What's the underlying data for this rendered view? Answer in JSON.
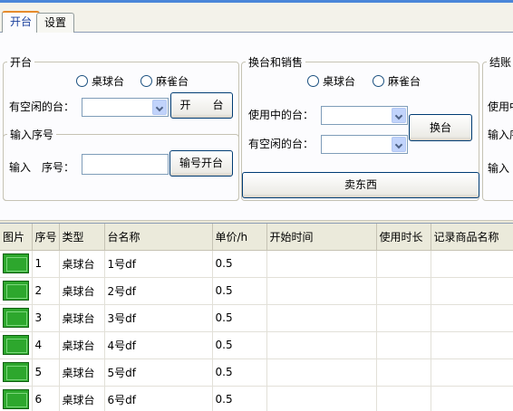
{
  "tabs": [
    {
      "label": "开台"
    },
    {
      "label": "设置"
    }
  ],
  "open_table": {
    "legend": "开台",
    "radio_billiards": "桌球台",
    "radio_mahjong": "麻雀台",
    "free_label": "有空闲的台：",
    "open_button": "开　　台",
    "serial_legend": "输入序号",
    "serial_label": "输入　序号：",
    "serial_open_button": "输号开台"
  },
  "switch_sell": {
    "legend": "换台和销售",
    "radio_billiards": "桌球台",
    "radio_mahjong": "麻雀台",
    "in_use_label": "使用中的台：",
    "free_label": "有空闲的台：",
    "switch_button": "换台",
    "sell_button": "卖东西"
  },
  "checkout": {
    "legend": "结账",
    "in_use_label": "使用中",
    "serial_label": "输入序",
    "input_label": "输入"
  },
  "grid": {
    "columns": [
      "图片",
      "序号",
      "类型",
      "台名称",
      "单价/h",
      "开始时间",
      "使用时长",
      "记录商品名称"
    ],
    "rows": [
      {
        "no": "1",
        "type": "桌球台",
        "name": "1号df",
        "price": "0.5",
        "start": "",
        "duration": "",
        "goods": ""
      },
      {
        "no": "2",
        "type": "桌球台",
        "name": "2号df",
        "price": "0.5",
        "start": "",
        "duration": "",
        "goods": ""
      },
      {
        "no": "3",
        "type": "桌球台",
        "name": "3号df",
        "price": "0.5",
        "start": "",
        "duration": "",
        "goods": ""
      },
      {
        "no": "4",
        "type": "桌球台",
        "name": "4号df",
        "price": "0.5",
        "start": "",
        "duration": "",
        "goods": ""
      },
      {
        "no": "5",
        "type": "桌球台",
        "name": "5号df",
        "price": "0.5",
        "start": "",
        "duration": "",
        "goods": ""
      },
      {
        "no": "6",
        "type": "桌球台",
        "name": "6号df",
        "price": "0.5",
        "start": "",
        "duration": "",
        "goods": ""
      }
    ]
  }
}
